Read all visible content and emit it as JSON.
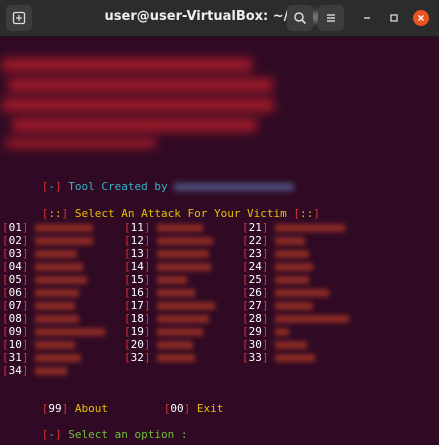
{
  "window": {
    "title": "user@user-VirtualBox: ~/",
    "colors": {
      "background": "#300a24",
      "bracket": "#d63434",
      "cyan": "#36b2c8",
      "yellow": "#e5c100",
      "green": "#6fbf3a"
    }
  },
  "terminal": {
    "credit_prefix": "Tool Created by",
    "credit_bracket": "-",
    "select_attack": "Select An Attack For Your Victim",
    "select_bracket": "::",
    "options_col1": [
      "01",
      "02",
      "03",
      "04",
      "05",
      "06",
      "07",
      "08",
      "09",
      "10",
      "31",
      "34"
    ],
    "options_col2": [
      "11",
      "12",
      "13",
      "14",
      "15",
      "16",
      "17",
      "18",
      "19",
      "20",
      "32"
    ],
    "options_col3": [
      "21",
      "22",
      "23",
      "24",
      "25",
      "26",
      "27",
      "28",
      "29",
      "30",
      "33"
    ],
    "about_num": "99",
    "about_label": "About",
    "exit_num": "00",
    "exit_label": "Exit",
    "prompt_bracket": "-",
    "prompt": "Select an option :"
  }
}
